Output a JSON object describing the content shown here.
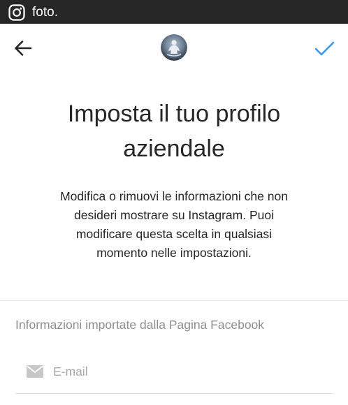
{
  "status_bar": {
    "caption": "foto.",
    "icon": "instagram-icon"
  },
  "nav": {
    "back_icon": "arrow-left-icon",
    "confirm_icon": "checkmark-icon",
    "confirm_color": "#3897f0"
  },
  "main": {
    "title_line1": "Imposta il tuo profilo",
    "title_line2": "aziendale",
    "description_line1": "Modifica o rimuovi le informazioni che non",
    "description_line2": "desideri mostrare su Instagram. Puoi",
    "description_line3": "modificare questa scelta in qualsiasi",
    "description_line4": "momento nelle impostazioni."
  },
  "imported_section": {
    "header": "Informazioni importate dalla Pagina Facebook",
    "email": {
      "icon": "mail-icon",
      "value": "",
      "placeholder": "E-mail"
    }
  }
}
